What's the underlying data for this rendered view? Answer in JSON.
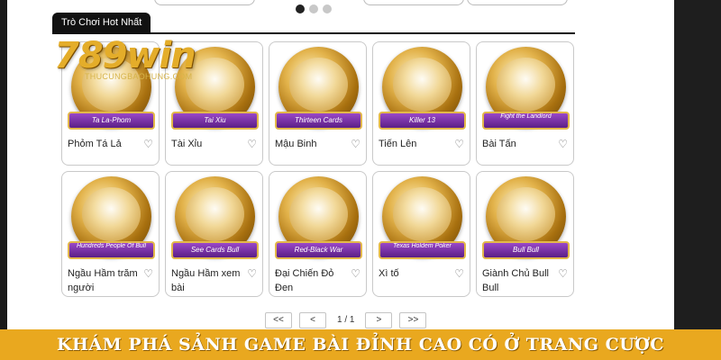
{
  "section": {
    "tab_label": "Trò Chơi Hot Nhất"
  },
  "logo": {
    "main": "789win",
    "sub": "THUCUNGBAOHUNG.COM"
  },
  "carousel": {
    "dots": 3,
    "active_index": 0
  },
  "games": [
    {
      "ribbon": "Ta La-Phom",
      "title": "Phỏm Tá Lả"
    },
    {
      "ribbon": "Tai Xiu",
      "title": "Tài Xỉu"
    },
    {
      "ribbon": "Thirteen Cards",
      "title": "Mậu Binh"
    },
    {
      "ribbon": "Killer 13",
      "title": "Tiến Lên"
    },
    {
      "ribbon": "Fight the Landlord",
      "title": "Bài Tấn"
    },
    {
      "ribbon": "Hundreds People Of Bull",
      "title": "Ngầu Hầm trăm người"
    },
    {
      "ribbon": "See Cards Bull",
      "title": "Ngầu Hầm xem bài"
    },
    {
      "ribbon": "Red-Black War",
      "title": "Đại Chiến Đỏ Đen"
    },
    {
      "ribbon": "Texas Holdem Poker",
      "title": "Xì tố"
    },
    {
      "ribbon": "Bull Bull",
      "title": "Giành Chủ Bull Bull"
    }
  ],
  "pagination": {
    "first": "<<",
    "prev": "<",
    "info": "1 / 1",
    "next": ">",
    "last": ">>"
  },
  "banner": {
    "text": "KHÁM PHÁ SẢNH GAME BÀI ĐỈNH CAO CÓ Ở TRANG CƯỢC"
  },
  "colors": {
    "banner_bg": "#e9a81f",
    "ribbon": "#6a2a96",
    "gold": "#e4ad2a"
  },
  "icons": {
    "favorite": "heart-outline-icon"
  }
}
